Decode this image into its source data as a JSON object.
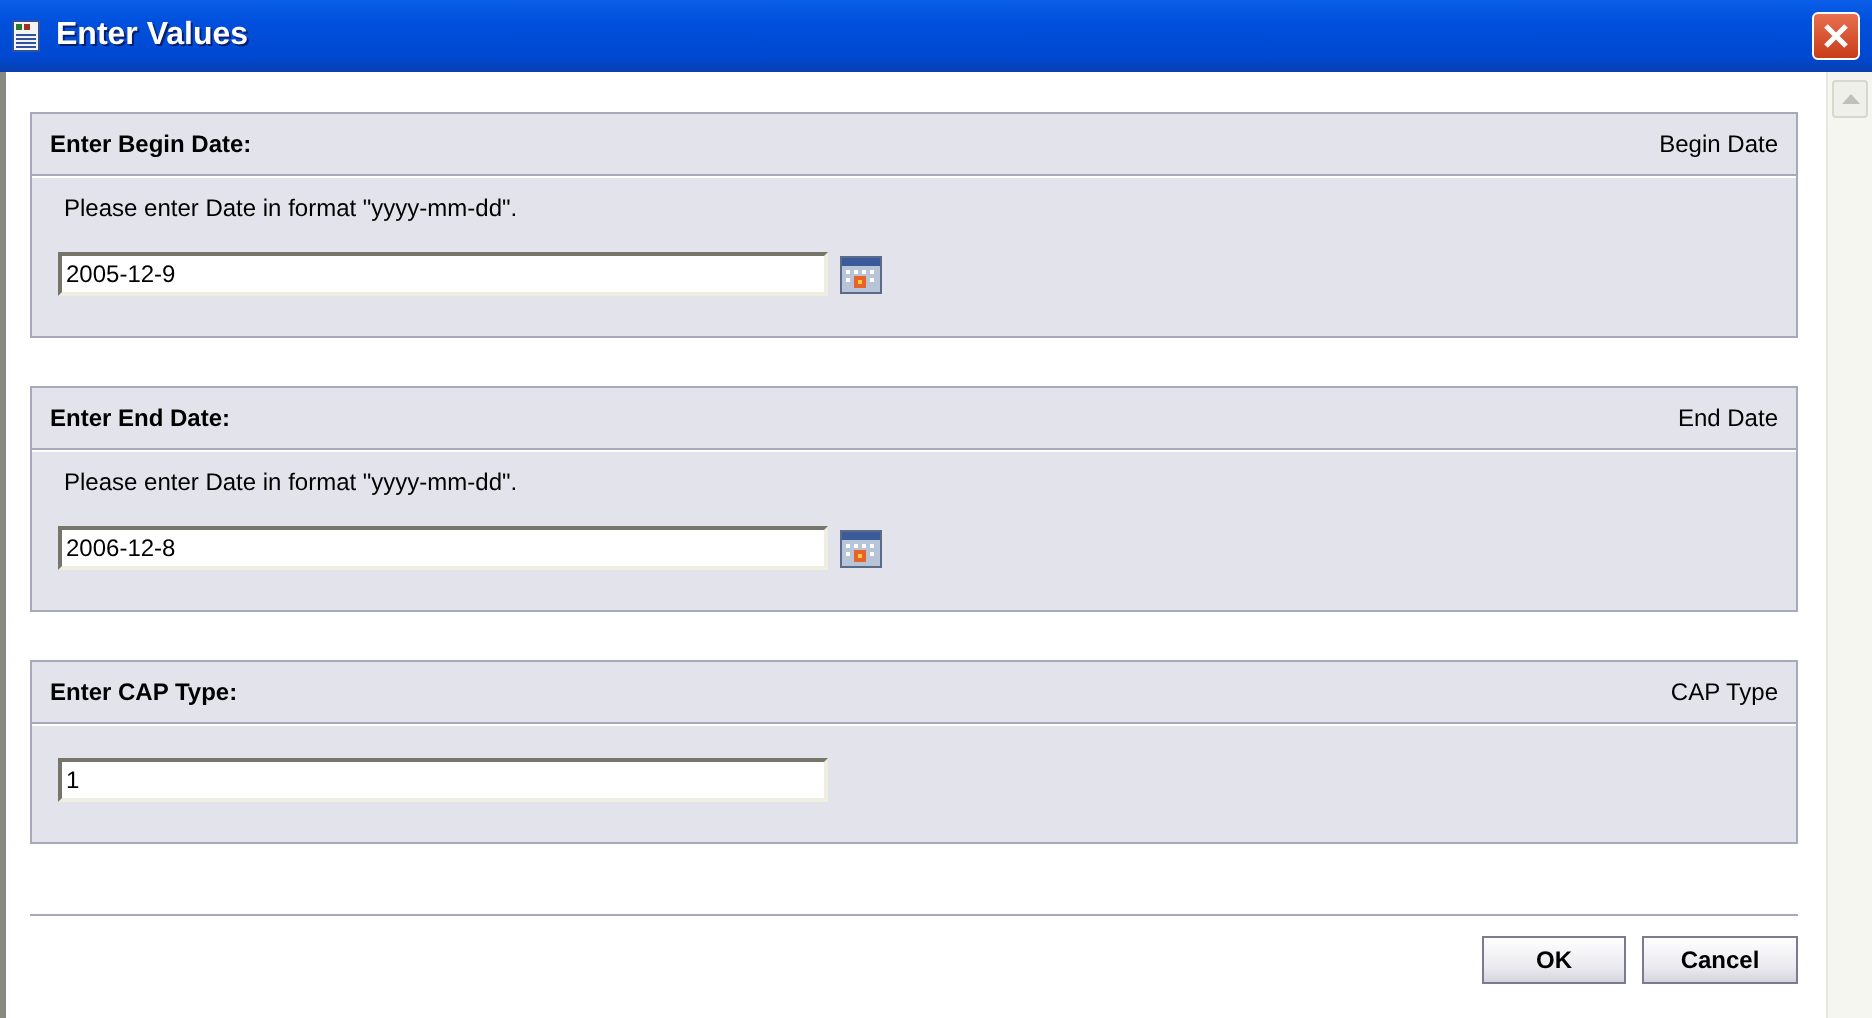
{
  "window": {
    "title": "Enter Values"
  },
  "sections": [
    {
      "kind": "date",
      "title": "Enter Begin Date:",
      "name": "Begin Date",
      "hint": "Please enter Date in format \"yyyy-mm-dd\".",
      "value": "2005-12-9"
    },
    {
      "kind": "date",
      "title": "Enter End Date:",
      "name": "End Date",
      "hint": "Please enter Date in format \"yyyy-mm-dd\".",
      "value": "2006-12-8"
    },
    {
      "kind": "text",
      "title": "Enter CAP Type:",
      "name": "CAP Type",
      "value": "1"
    }
  ],
  "buttons": [
    "OK",
    "Cancel"
  ]
}
